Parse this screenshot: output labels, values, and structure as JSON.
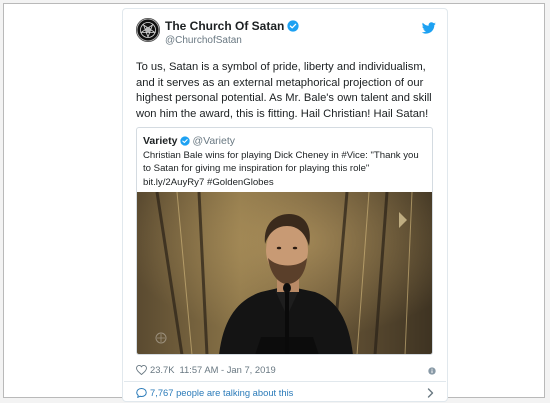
{
  "tweet": {
    "author_name": "The Church Of Satan",
    "author_handle": "@ChurchofSatan",
    "text": "To us, Satan is a symbol of pride, liberty and individualism, and it serves as an external metaphorical projection of our highest personal potential. As Mr. Bale's own talent and skill won him the award, this is fitting. Hail Christian! Hail Satan!",
    "likes": "23.7K",
    "timestamp": "11:57 AM - Jan 7, 2019",
    "talking": "7,767 people are talking about this"
  },
  "quoted_tweet": {
    "author_name": "Variety",
    "author_handle": "@Variety",
    "text": "Christian Bale wins for playing Dick Cheney in #Vice: \"Thank you to Satan for giving me inspiration for playing this role\" bit.ly/2AuyRy7 #GoldenGlobes"
  },
  "colors": {
    "twitter_blue": "#1da1f2",
    "link_blue": "#2b7bb9",
    "muted_gray": "#697882",
    "text_dark": "#1c2022"
  },
  "icons": [
    "church-logo-avatar",
    "verified-badge-icon",
    "twitter-bird-icon",
    "heart-icon",
    "info-icon",
    "speech-bubble-icon",
    "chevron-right-icon"
  ]
}
